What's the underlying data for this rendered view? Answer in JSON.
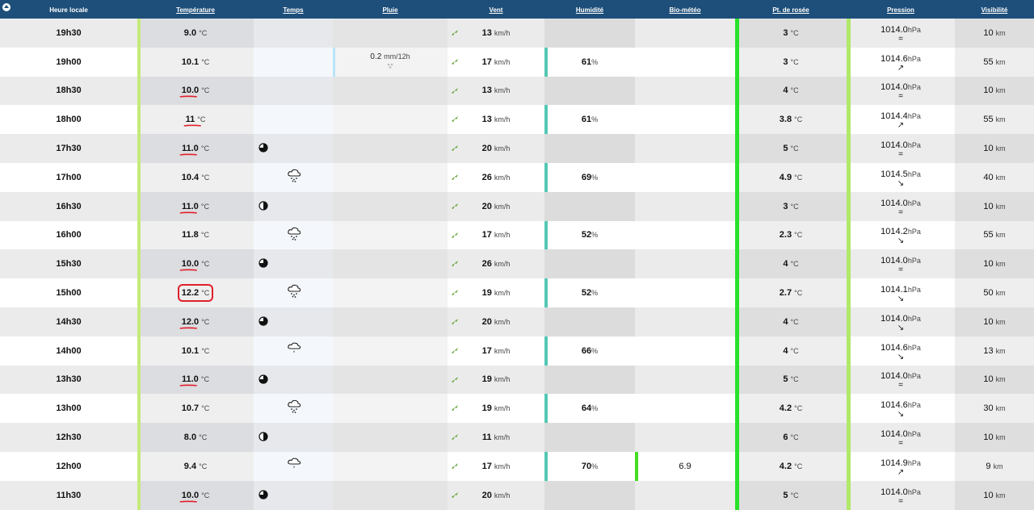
{
  "headers": [
    "Heure locale",
    "Température",
    "Temps",
    "Pluie",
    "Vent",
    "Humidité",
    "Bio-météo",
    "Pt. de rosée",
    "Pression",
    "Visibilité"
  ],
  "units": {
    "temp": "°C",
    "wind": "km/h",
    "hum": "%",
    "pressure": "hPa",
    "vis": "km",
    "rain": "mm/12h"
  },
  "rows": [
    {
      "time": "19h30",
      "temp": "9.0",
      "mark": "none",
      "icon": "none",
      "rain": "",
      "wind": "13",
      "hum": "",
      "bio": "",
      "dew": "3",
      "pressure": "1014.0",
      "trend": "=",
      "vis": "10"
    },
    {
      "time": "19h00",
      "temp": "10.1",
      "mark": "none",
      "icon": "none",
      "rain": "0.2",
      "wind": "17",
      "hum": "61",
      "bio": "",
      "dew": "3",
      "pressure": "1014.6",
      "trend": "↗",
      "vis": "55"
    },
    {
      "time": "18h30",
      "temp": "10.0",
      "mark": "underline",
      "icon": "none",
      "rain": "",
      "wind": "13",
      "hum": "",
      "bio": "",
      "dew": "4",
      "pressure": "1014.0",
      "trend": "=",
      "vis": "10"
    },
    {
      "time": "18h00",
      "temp": "11",
      "mark": "underline",
      "icon": "none",
      "rain": "",
      "wind": "13",
      "hum": "61",
      "bio": "",
      "dew": "3.8",
      "pressure": "1014.4",
      "trend": "↗",
      "vis": "55"
    },
    {
      "time": "17h30",
      "temp": "11.0",
      "mark": "underline",
      "icon": "moon-3q",
      "rain": "",
      "wind": "20",
      "hum": "",
      "bio": "",
      "dew": "5",
      "pressure": "1014.0",
      "trend": "=",
      "vis": "10"
    },
    {
      "time": "17h00",
      "temp": "10.4",
      "mark": "none",
      "icon": "cloud-snow",
      "rain": "",
      "wind": "26",
      "hum": "69",
      "bio": "",
      "dew": "4.9",
      "pressure": "1014.5",
      "trend": "↘",
      "vis": "40"
    },
    {
      "time": "16h30",
      "temp": "11.0",
      "mark": "underline",
      "icon": "moon-half",
      "rain": "",
      "wind": "20",
      "hum": "",
      "bio": "",
      "dew": "3",
      "pressure": "1014.0",
      "trend": "=",
      "vis": "10"
    },
    {
      "time": "16h00",
      "temp": "11.8",
      "mark": "none",
      "icon": "cloud-snow",
      "rain": "",
      "wind": "17",
      "hum": "52",
      "bio": "",
      "dew": "2.3",
      "pressure": "1014.2",
      "trend": "↘",
      "vis": "55"
    },
    {
      "time": "15h30",
      "temp": "10.0",
      "mark": "underline",
      "icon": "moon-3q",
      "rain": "",
      "wind": "26",
      "hum": "",
      "bio": "",
      "dew": "4",
      "pressure": "1014.0",
      "trend": "=",
      "vis": "10"
    },
    {
      "time": "15h00",
      "temp": "12.2",
      "mark": "circle",
      "icon": "cloud-snow",
      "rain": "",
      "wind": "19",
      "hum": "52",
      "bio": "",
      "dew": "2.7",
      "pressure": "1014.1",
      "trend": "↘",
      "vis": "50"
    },
    {
      "time": "14h30",
      "temp": "12.0",
      "mark": "underline",
      "icon": "moon-3q",
      "rain": "",
      "wind": "20",
      "hum": "",
      "bio": "",
      "dew": "4",
      "pressure": "1014.0",
      "trend": "↘",
      "vis": "10"
    },
    {
      "time": "14h00",
      "temp": "10.1",
      "mark": "none",
      "icon": "cloud-drop",
      "rain": "",
      "wind": "17",
      "hum": "66",
      "bio": "",
      "dew": "4",
      "pressure": "1014.6",
      "trend": "↘",
      "vis": "13"
    },
    {
      "time": "13h30",
      "temp": "11.0",
      "mark": "underline",
      "icon": "moon-3q",
      "rain": "",
      "wind": "19",
      "hum": "",
      "bio": "",
      "dew": "5",
      "pressure": "1014.0",
      "trend": "=",
      "vis": "10"
    },
    {
      "time": "13h00",
      "temp": "10.7",
      "mark": "none",
      "icon": "cloud-snow",
      "rain": "",
      "wind": "19",
      "hum": "64",
      "bio": "",
      "dew": "4.2",
      "pressure": "1014.6",
      "trend": "↘",
      "vis": "30"
    },
    {
      "time": "12h30",
      "temp": "8.0",
      "mark": "none",
      "icon": "moon-half",
      "rain": "",
      "wind": "11",
      "hum": "",
      "bio": "",
      "dew": "6",
      "pressure": "1014.0",
      "trend": "=",
      "vis": "10"
    },
    {
      "time": "12h00",
      "temp": "9.4",
      "mark": "none",
      "icon": "cloud-drop",
      "rain": "",
      "wind": "17",
      "hum": "70",
      "bio": "6.9",
      "dew": "4.2",
      "pressure": "1014.9",
      "trend": "↗",
      "vis": "9"
    },
    {
      "time": "11h30",
      "temp": "10.0",
      "mark": "underline",
      "icon": "moon-3q",
      "rain": "",
      "wind": "20",
      "hum": "",
      "bio": "",
      "dew": "5",
      "pressure": "1014.0",
      "trend": "=",
      "vis": "10"
    }
  ]
}
